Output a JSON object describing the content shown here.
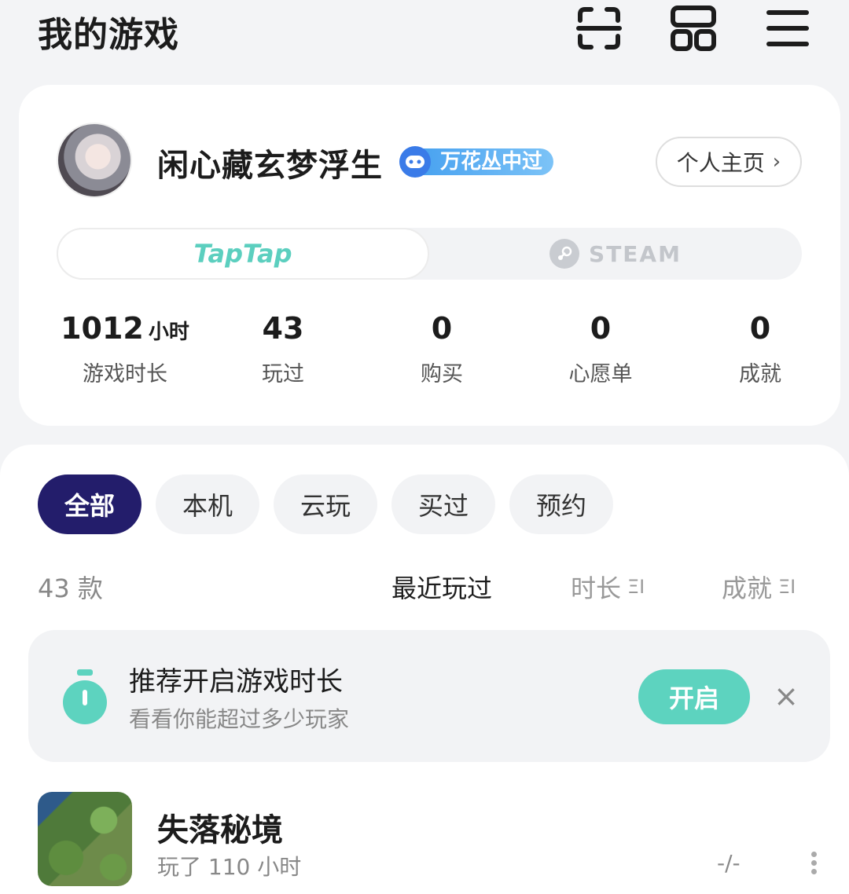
{
  "header": {
    "title": "我的游戏",
    "icons": [
      "scan-icon",
      "apps-icon",
      "menu-icon"
    ]
  },
  "profile": {
    "username": "闲心藏玄梦浮生",
    "badge_label": "万花丛中过",
    "homepage_label": "个人主页",
    "homepage_chevron": "›",
    "platforms": {
      "taptap": "TapTap",
      "steam": "STEAM",
      "active": "TapTap"
    },
    "stats": [
      {
        "value": "1012",
        "unit": "小时",
        "label": "游戏时长"
      },
      {
        "value": "43",
        "unit": "",
        "label": "玩过"
      },
      {
        "value": "0",
        "unit": "",
        "label": "购买"
      },
      {
        "value": "0",
        "unit": "",
        "label": "心愿单"
      },
      {
        "value": "0",
        "unit": "",
        "label": "成就"
      }
    ]
  },
  "filters": {
    "chips": [
      "全部",
      "本机",
      "云玩",
      "买过",
      "预约"
    ],
    "active": "全部"
  },
  "sort": {
    "count": "43 款",
    "options": [
      {
        "label": "最近玩过",
        "icon": ""
      },
      {
        "label": "时长",
        "icon": "ΞI"
      },
      {
        "label": "成就",
        "icon": "ΞI"
      }
    ],
    "active": "最近玩过"
  },
  "banner": {
    "title": "推荐开启游戏时长",
    "subtitle": "看看你能超过多少玩家",
    "button_label": "开启",
    "close_glyph": "×",
    "accent_color": "#5dd3bf"
  },
  "games": [
    {
      "name": "失落秘境",
      "playtime": "玩了 110 小时",
      "achievements": "-/-"
    }
  ],
  "colors": {
    "active_chip": "#231d6b",
    "taptap": "#5ccfbf",
    "badge": "#3a7be8"
  }
}
